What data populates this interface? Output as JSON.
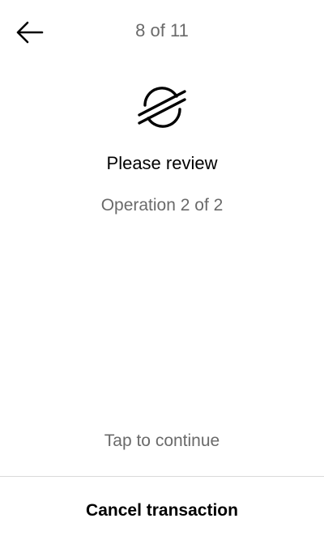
{
  "header": {
    "back_icon": "arrow-left-icon",
    "counter": "8 of 11"
  },
  "content": {
    "logo_icon": "stellar-logo-icon",
    "title": "Please review",
    "subtitle": "Operation 2 of 2"
  },
  "footer": {
    "hint": "Tap to continue",
    "cancel_label": "Cancel transaction"
  },
  "colors": {
    "primary_text": "#000000",
    "secondary_text": "#6a6a6a",
    "divider": "#d9d9d9",
    "background": "#ffffff"
  }
}
